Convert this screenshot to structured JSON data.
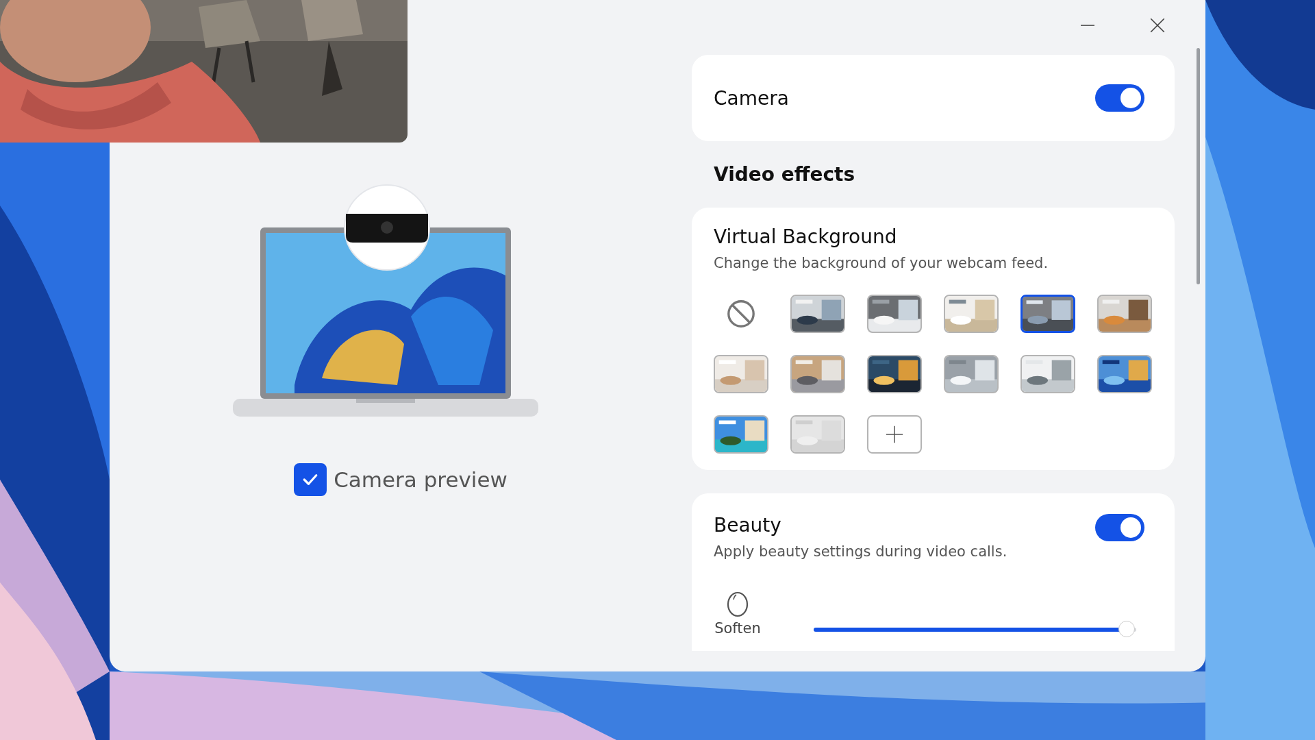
{
  "camera_preview": {
    "label": "Camera preview",
    "checked": true
  },
  "camera": {
    "label": "Camera",
    "on": true
  },
  "section_title": "Video effects",
  "virtual_background": {
    "title": "Virtual Background",
    "description": "Change the background of your webcam feed.",
    "options": [
      {
        "kind": "none",
        "selected": false
      },
      {
        "kind": "picture",
        "selected": false
      },
      {
        "kind": "picture",
        "selected": false
      },
      {
        "kind": "picture",
        "selected": false
      },
      {
        "kind": "picture",
        "selected": true
      },
      {
        "kind": "picture",
        "selected": false
      },
      {
        "kind": "picture",
        "selected": false
      },
      {
        "kind": "picture",
        "selected": false
      },
      {
        "kind": "picture",
        "selected": false
      },
      {
        "kind": "picture",
        "selected": false
      },
      {
        "kind": "picture",
        "selected": false
      },
      {
        "kind": "picture",
        "selected": false
      },
      {
        "kind": "picture",
        "selected": false
      },
      {
        "kind": "picture",
        "selected": false
      },
      {
        "kind": "add",
        "selected": false
      }
    ]
  },
  "beauty": {
    "title": "Beauty",
    "description": "Apply beauty settings during video calls.",
    "on": true,
    "slider": {
      "label": "Soften",
      "level": 0.97
    }
  }
}
